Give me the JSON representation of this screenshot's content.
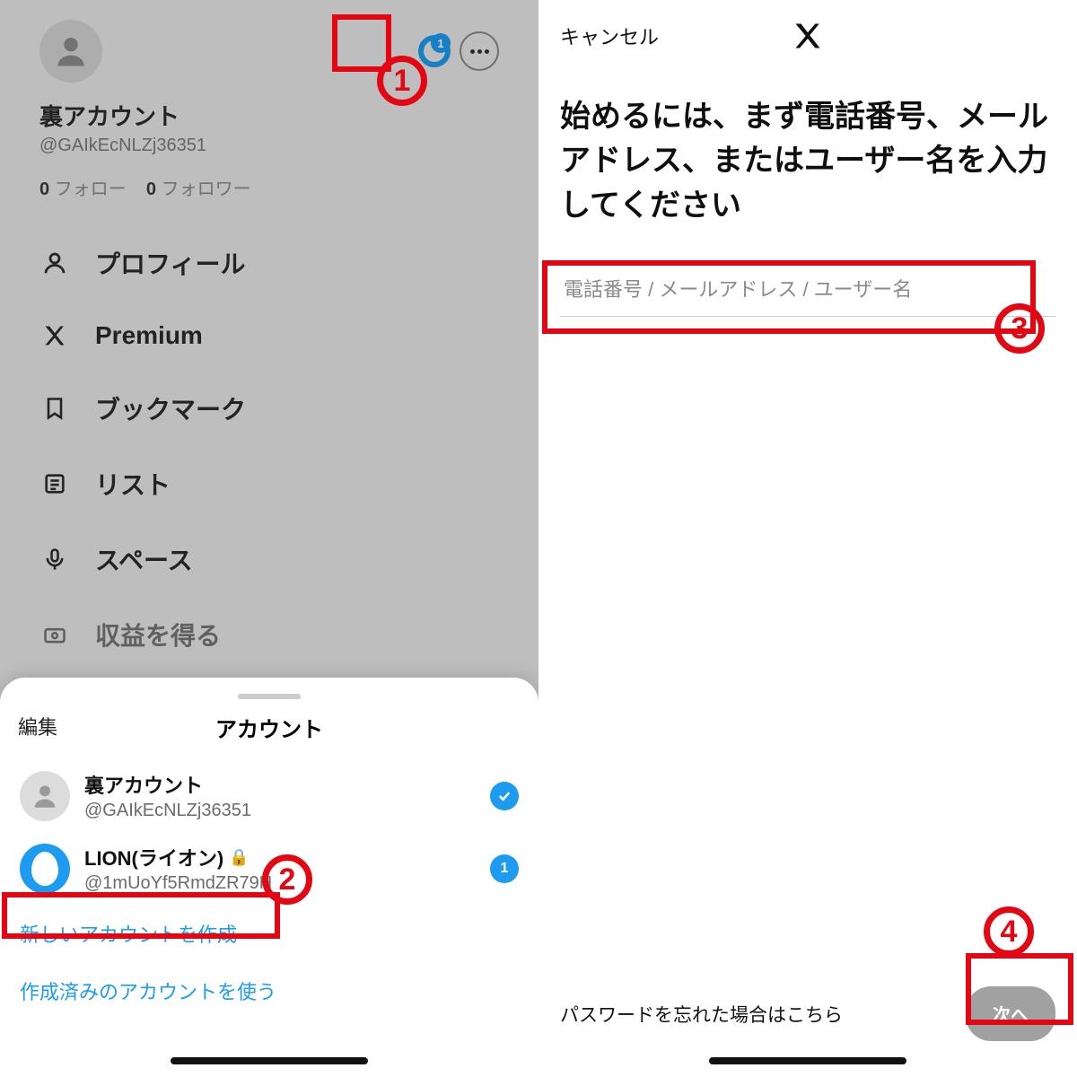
{
  "left": {
    "donut_badge": "1",
    "display_name": "裏アカウント",
    "handle": "@GAIkEcNLZj36351",
    "following_count": "0",
    "following_label": "フォロー",
    "followers_count": "0",
    "followers_label": "フォロワー",
    "nav": {
      "profile": "プロフィール",
      "premium": "Premium",
      "bookmarks": "ブックマーク",
      "list": "リスト",
      "spaces": "スペース",
      "monetize": "収益を得る"
    }
  },
  "sheet": {
    "edit": "編集",
    "title": "アカウント",
    "acct1_name": "裏アカウント",
    "acct1_handle": "@GAIkEcNLZj36351",
    "acct2_name": "LION(ライオン)",
    "acct2_handle": "@1mUoYf5RmdZR79H",
    "acct2_badge": "1",
    "create_new": "新しいアカウントを作成",
    "use_existing": "作成済みのアカウントを使う"
  },
  "right": {
    "cancel": "キャンセル",
    "headline": "始めるには、まず電話番号、メールアドレス、またはユーザー名を入力してください",
    "input_placeholder": "電話番号 / メールアドレス / ユーザー名",
    "forgot": "パスワードを忘れた場合はこちら",
    "next": "次へ"
  },
  "annotations": {
    "n1": "1",
    "n2": "2",
    "n3": "3",
    "n4": "4"
  }
}
